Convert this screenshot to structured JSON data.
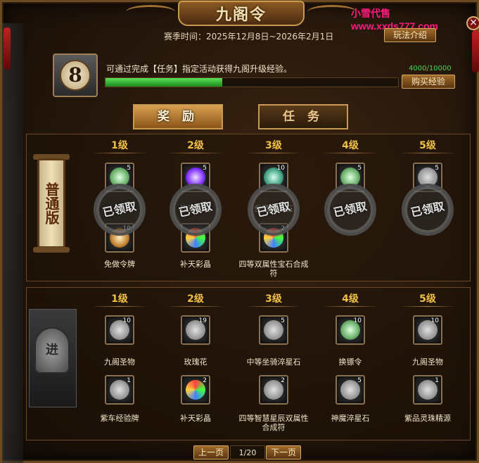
{
  "window": {
    "title": "九阁令",
    "watermark": "小雪代售www.xxds777.com",
    "close_glyph": "×"
  },
  "header": {
    "season_label": "赛季时间：2025年12月8日~2026年2月1日",
    "rules_button": "玩法介绍",
    "level": "8",
    "description": "可通过完成【任务】指定活动获得九阁升级经验。",
    "exp_text": "4000/10000",
    "exp_progress": 0.4,
    "buy_button": "购买经验"
  },
  "tabs": [
    {
      "label": "奖 励",
      "active": true
    },
    {
      "label": "任 务",
      "active": false
    }
  ],
  "levels": [
    "1级",
    "2级",
    "3级",
    "4级",
    "5级"
  ],
  "normal_tier": {
    "banner": "普通版",
    "claimed_label": "已领取",
    "top_row": [
      {
        "count": "5",
        "icon": "jade-token-icon"
      },
      {
        "count": "5",
        "icon": "purple-crystal-icon"
      },
      {
        "count": "10",
        "icon": "teal-star-stone-icon"
      },
      {
        "count": "5",
        "icon": "exchange-token-icon"
      },
      {
        "count": "5",
        "icon": "relic-icon"
      }
    ],
    "top_row_labels": [
      "",
      "玫瑰星石",
      "坐骑淬星石",
      "",
      ""
    ],
    "bottom_row": [
      {
        "count": "10",
        "icon": "exempt-token-icon",
        "name": "免做令牌"
      },
      {
        "count": "",
        "icon": "colorful-crystal-icon",
        "name": "补天彩晶"
      },
      {
        "count": "2",
        "icon": "gem-talisman-icon",
        "name": "四等双属性宝石合成符"
      },
      null,
      null
    ]
  },
  "advanced_tier": {
    "banner": "进",
    "top_row": [
      {
        "count": "10",
        "icon": "relic-icon",
        "name": "九阁圣物"
      },
      {
        "count": "19",
        "icon": "rose-icon",
        "name": "玫瑰花"
      },
      {
        "count": "5",
        "icon": "star-stone-icon",
        "name": "中等坐骑淬星石"
      },
      {
        "count": "10",
        "icon": "exchange-token-icon",
        "name": "换镖令"
      },
      {
        "count": "10",
        "icon": "relic-icon",
        "name": "九阁圣物"
      }
    ],
    "bottom_row": [
      {
        "count": "1",
        "icon": "exp-plate-icon",
        "name": "紫车经验牌"
      },
      {
        "count": "2",
        "icon": "colorful-crystal-icon",
        "name": "补天彩晶"
      },
      {
        "count": "2",
        "icon": "talisman-icon",
        "name": "四等智慧星辰双属性合成符"
      },
      {
        "count": "5",
        "icon": "demon-stone-icon",
        "name": "神魔淬星石"
      },
      {
        "count": "1",
        "icon": "pearl-icon",
        "name": "紫品灵珠精源"
      }
    ]
  },
  "pagination": {
    "prev": "上一页",
    "current": "1/20",
    "next": "下一页"
  }
}
